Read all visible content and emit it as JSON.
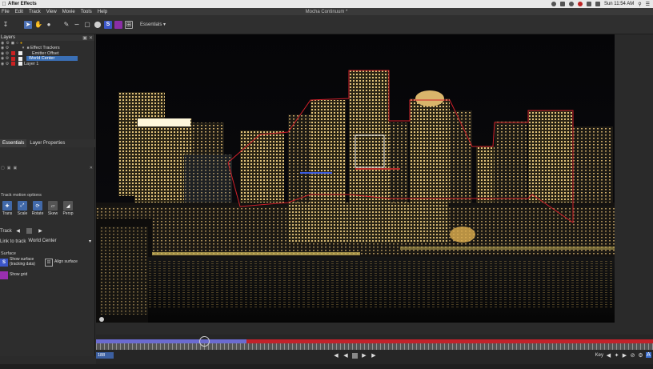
{
  "macos": {
    "app_name": "After Effects",
    "clock": "Sun 11:54 AM",
    "tray_icons": [
      "mocha-tray-icon",
      "dropbox-icon",
      "gear-icon",
      "record-icon",
      "wifi-icon",
      "battery-icon",
      "search-icon",
      "list-icon"
    ]
  },
  "window": {
    "title": "Mocha Continuum *",
    "menus": [
      "File",
      "Edit",
      "Track",
      "View",
      "Movie",
      "Tools",
      "Help"
    ]
  },
  "toolbar": {
    "workspace": "Essentials"
  },
  "layers_panel": {
    "title": "Layers",
    "items": [
      {
        "name": "Effect Trackers",
        "kind": "folder"
      },
      {
        "name": "Emitter Offset",
        "kind": "layer"
      },
      {
        "name": "World Center",
        "kind": "layer",
        "selected": true
      },
      {
        "name": "Layer 1",
        "kind": "layer"
      }
    ]
  },
  "params_tabs": [
    "Essentials",
    "Layer Properties"
  ],
  "track_motion": {
    "label": "Track motion options",
    "options": [
      "Trans",
      "Scale",
      "Rotate",
      "Skew",
      "Persp"
    ]
  },
  "track": {
    "label": "Track"
  },
  "link_to_track": {
    "label": "Link to track",
    "value": "World Center"
  },
  "surface": {
    "label": "Surface",
    "show_surface": "Show surface\n(tracking data)",
    "align_surface": "Align surface",
    "show_grid": "Show grid"
  },
  "timeline": {
    "frame": "188",
    "progress": 0.27,
    "key_label": "Key"
  },
  "colors": {
    "accent_blue": "#4169a9",
    "track_red": "#c2222a",
    "tracked_purple": "#6b6bd0"
  }
}
